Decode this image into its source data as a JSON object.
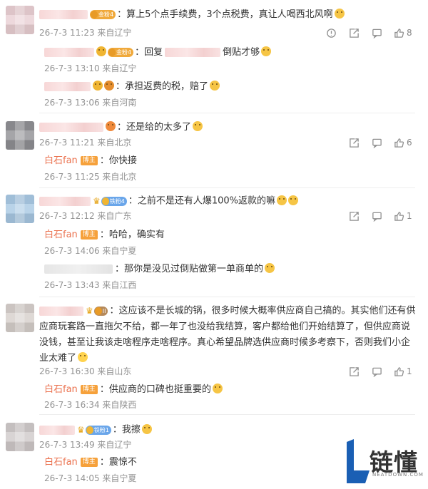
{
  "colors": {
    "author": "#eb7350",
    "time": "#939393",
    "accent_blue": "#1a5fb4"
  },
  "comments": [
    {
      "badge": "金粉4",
      "text": "：算上5个点手续费，3个点税费，真让人喝西北风啊",
      "time": "26-7-3 11:23 来自辽宁",
      "likes": "8",
      "replies": [
        {
          "badge": "金粉4",
          "text": "：回复",
          "tail": "倒贴才够",
          "time": "26-7-3 13:10 来自辽宁"
        },
        {
          "text": "：承担返费的税，赔了",
          "time": "26-7-3 13:06 来自河南"
        }
      ]
    },
    {
      "text": "：还是给的太多了",
      "time": "26-7-3 11:21 来自北京",
      "likes": "6",
      "replies": [
        {
          "author": "白石fan",
          "tag": "博主",
          "text": "：你快接",
          "time": "26-7-3 11:25 来自北京"
        }
      ]
    },
    {
      "badge": "铁粉4",
      "text": "：之前不是还有人爆100%返款的嘛",
      "time": "26-7-3 12:12 来自广东",
      "likes": "1",
      "replies": [
        {
          "author": "白石fan",
          "tag": "博主",
          "text": "：哈哈，确实有",
          "time": "26-7-3 14:06 来自宁夏"
        },
        {
          "text": "：那你是没见过倒贴做第一单商单的",
          "time": "26-7-3 13:43 来自江西"
        }
      ]
    },
    {
      "badge": "II",
      "text": "：这应该不是长城的锅，很多时候大概率供应商自己搞的。其实他们还有供应商玩套路一直拖欠不给，都一年了也没给我结算，客户都给他们开始结算了，但供应商说没钱，甚至让我该走啥程序走啥程序。真心希望品牌选供应商时候多考察下，否则我们小企业太难了",
      "time": "26-7-3 16:30 来自山东",
      "likes": "1",
      "replies": [
        {
          "author": "白石fan",
          "tag": "博主",
          "text": "：供应商的口碑也挺重要的",
          "time": "26-7-3 16:34 来自陕西"
        }
      ]
    },
    {
      "badge": "铁粉1",
      "text": "：我擦",
      "time": "26-7-3 13:49 来自辽宁",
      "replies": [
        {
          "author": "白石fan",
          "tag": "博主",
          "text": "：震惊不",
          "time": "26-7-3 14:05 来自宁夏"
        }
      ]
    }
  ],
  "logo": {
    "mark": "L",
    "name": "链懂",
    "sub": "NEATDOWN.COM"
  },
  "icons": [
    "report-icon",
    "share-icon",
    "comment-icon",
    "like-icon"
  ]
}
